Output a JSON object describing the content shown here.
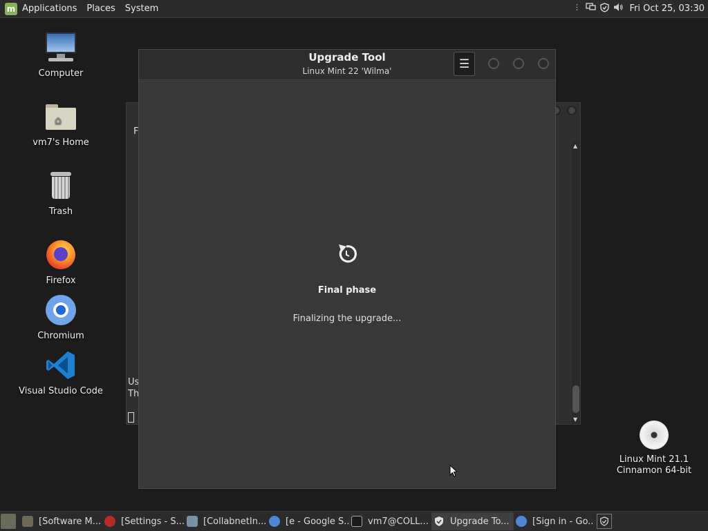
{
  "top_panel": {
    "menus": [
      "Applications",
      "Places",
      "System"
    ],
    "clock": "Fri Oct 25, 03:30"
  },
  "desktop_icons": [
    {
      "label": "Computer",
      "icon": "computer-icon"
    },
    {
      "label": "vm7's Home",
      "icon": "home-folder-icon"
    },
    {
      "label": "Trash",
      "icon": "trash-icon"
    },
    {
      "label": "Firefox",
      "icon": "firefox-icon"
    },
    {
      "label": "Chromium",
      "icon": "chromium-icon"
    },
    {
      "label": "Visual Studio Code",
      "icon": "vscode-icon"
    },
    {
      "label": "Linux Mint 21.1 Cinnamon 64-bit",
      "icon": "dvd-icon"
    }
  ],
  "background_window": {
    "partial_texts": [
      "F",
      "Us",
      "Th"
    ]
  },
  "window": {
    "title": "Upgrade Tool",
    "subtitle": "Linux Mint 22 'Wilma'",
    "menu_icon": "hamburger-menu-icon",
    "phase_title": "Final phase",
    "phase_desc": "Finalizing the upgrade...",
    "status_icon": "restart-arrow-icon"
  },
  "taskbar": {
    "tasks": [
      {
        "label": "[Software M...",
        "icon": "software-manager-icon",
        "active": false
      },
      {
        "label": "[Settings - S...",
        "icon": "settings-icon",
        "active": false
      },
      {
        "label": "[CollabnetIn...",
        "icon": "installer-icon",
        "active": false
      },
      {
        "label": "[e - Google S...",
        "icon": "chromium-icon",
        "active": false
      },
      {
        "label": "vm7@COLL...",
        "icon": "terminal-icon",
        "active": false
      },
      {
        "label": "Upgrade To...",
        "icon": "shield-icon",
        "active": true
      },
      {
        "label": "[Sign in - Go...",
        "icon": "chromium-icon",
        "active": false
      }
    ]
  }
}
